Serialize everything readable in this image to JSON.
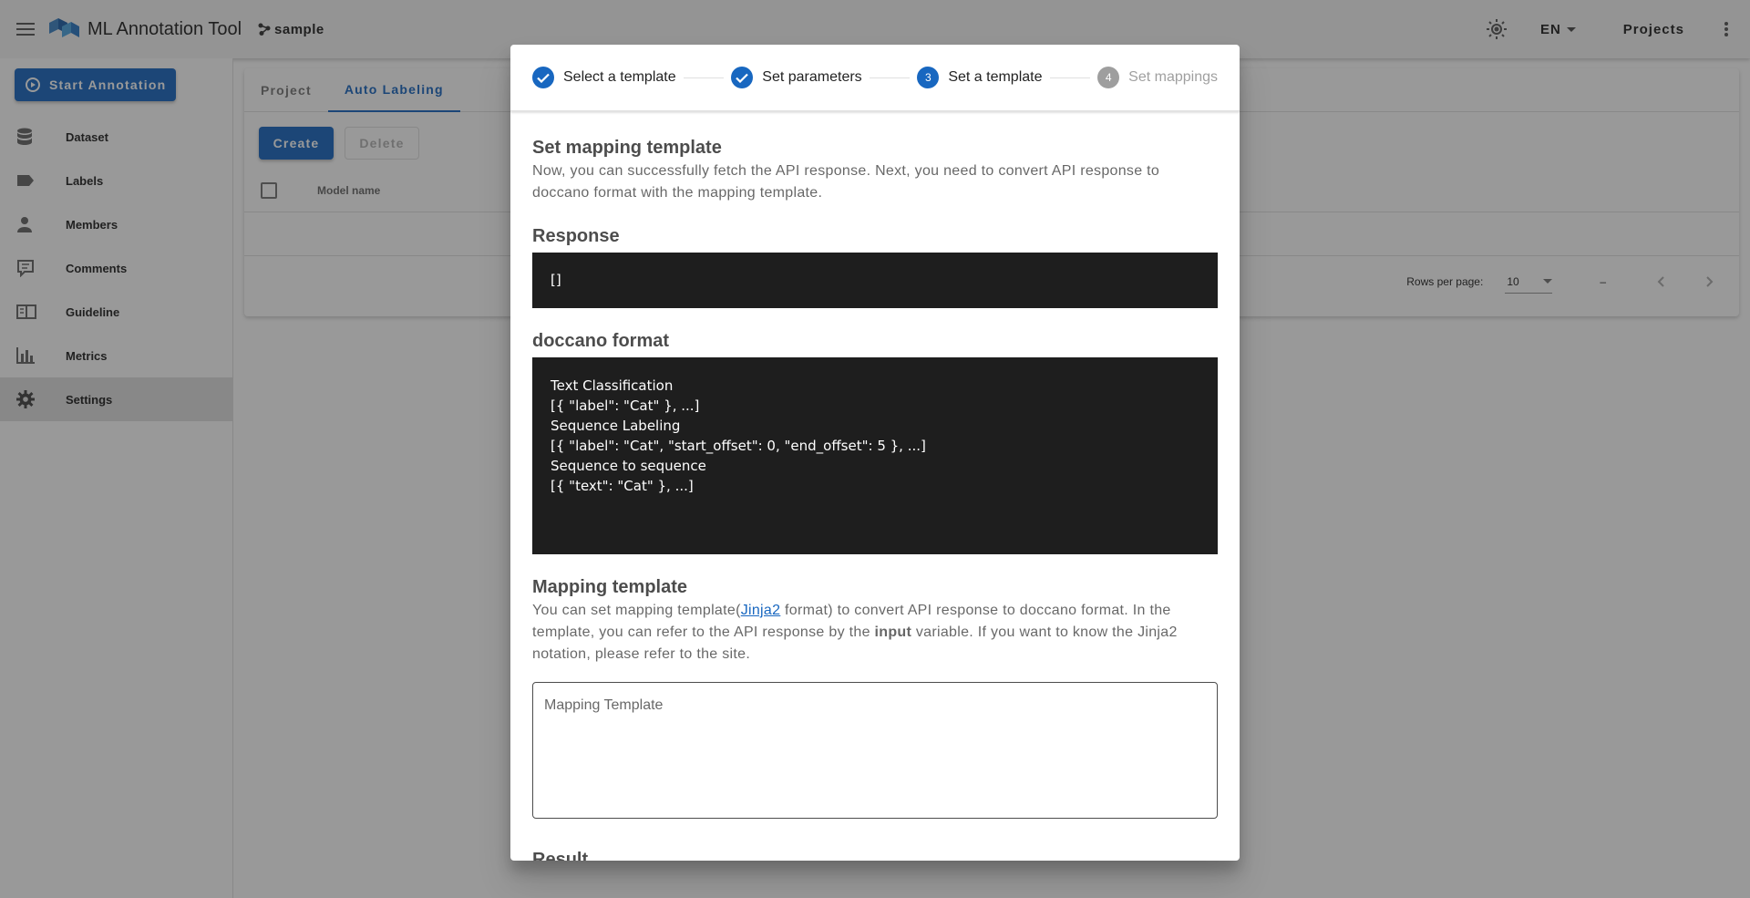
{
  "app": {
    "title": "ML Annotation Tool",
    "project": "sample",
    "language": "EN",
    "projects_label": "Projects"
  },
  "sidebar": {
    "start_label": "Start Annotation",
    "items": [
      {
        "label": "Dataset",
        "icon": "database-icon"
      },
      {
        "label": "Labels",
        "icon": "label-icon"
      },
      {
        "label": "Members",
        "icon": "account-icon"
      },
      {
        "label": "Comments",
        "icon": "comment-icon"
      },
      {
        "label": "Guideline",
        "icon": "book-icon"
      },
      {
        "label": "Metrics",
        "icon": "chart-icon"
      },
      {
        "label": "Settings",
        "icon": "gear-icon"
      }
    ]
  },
  "main": {
    "tabs": [
      "Project",
      "Auto Labeling"
    ],
    "create_label": "Create",
    "delete_label": "Delete",
    "column_model": "Model name",
    "rows_per_page_label": "Rows per page:",
    "rows_per_page_value": "10",
    "page_range": "–"
  },
  "dialog": {
    "steps": [
      {
        "label": "Select a template",
        "state": "done"
      },
      {
        "label": "Set parameters",
        "state": "done"
      },
      {
        "number": "3",
        "label": "Set a template",
        "state": "active"
      },
      {
        "number": "4",
        "label": "Set mappings",
        "state": "pending"
      }
    ],
    "intro_title": "Set mapping template",
    "intro_text": "Now, you can successfully fetch the API response. Next, you need to convert API response to doccano format with the mapping template.",
    "response_title": "Response",
    "response_value": "[]",
    "format_title": "doccano format",
    "format_lines": [
      "Text Classification",
      "[{ \"label\": \"Cat\" }, ...]",
      "",
      "Sequence Labeling",
      "[{ \"label\": \"Cat\", \"start_offset\": 0, \"end_offset\": 5 }, ...]",
      "",
      "Sequence to sequence",
      "[{ \"text\": \"Cat\" }, ...]"
    ],
    "mapping_title": "Mapping template",
    "mapping_text_before": "You can set mapping template(",
    "mapping_link": "Jinja2",
    "mapping_text_middle": " format) to convert API response to doccano format. In the template, you can refer to the API response by the ",
    "mapping_bold": "input",
    "mapping_text_after": " variable. If you want to know the Jinja2 notation, please refer to the site.",
    "mapping_placeholder": "Mapping Template",
    "result_title": "Result"
  },
  "colors": {
    "primary": "#1867c0",
    "code_bg": "#1e1e1e",
    "overlay": "rgba(33,33,33,0.46)"
  }
}
